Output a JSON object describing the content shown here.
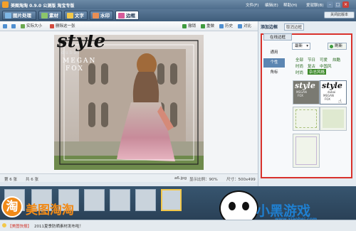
{
  "app": {
    "title": "美图淘淘 0.9.0 公测版 淘宝专版",
    "menu": [
      "文件(F)",
      "编辑(E)",
      "帮助(H)"
    ],
    "user": "爱就聊(B)",
    "new_version": "关闭此版本"
  },
  "tabs": [
    "图片处理",
    "素材",
    "文字",
    "水印",
    "边框"
  ],
  "toolbar": {
    "zoom_in": "",
    "zoom_out": "",
    "actual_size": "实际大小",
    "delete": "删除这一张",
    "undo": "撤销",
    "redo": "重做",
    "history": "历史",
    "compare": "对比"
  },
  "photo": {
    "style_word": "style",
    "subtitle": "dubai",
    "name1": "MEGAN",
    "name2": "FOX"
  },
  "status": {
    "index": "第 6 张",
    "total": "共 6 张",
    "filename": "a6.jpg",
    "zoom": "显示比例：90%",
    "size": "尺寸：500x499"
  },
  "panel": {
    "tab_add": "添加边框",
    "tab_cancel": "取消边框",
    "online": "在线边框",
    "sidebar": [
      "通用",
      "个性",
      "角标"
    ],
    "filter": "最新",
    "refresh": "刷新",
    "categories": [
      [
        "全部",
        "节日",
        "可爱",
        "炫酷"
      ],
      [
        "时尚",
        "复古",
        "中国风"
      ],
      [
        "时尚",
        "杂志风格"
      ]
    ],
    "highlight": "杂志风格"
  },
  "thumb": {
    "style_word": "style",
    "sub": "dubai",
    "name1": "MEGAN",
    "name2": "FOX"
  },
  "news": {
    "prefix": "【美图快报】",
    "text": "2011夏季防晒素材发布啦！"
  },
  "brand": {
    "logo_char": "淘",
    "name": "美图淘淘",
    "site_big": "小黑游戏",
    "site_url": "www.xiaohei.com"
  },
  "colors": {
    "accent": "#d9322c",
    "brand_orange": "#f08a18",
    "link_green": "#2a6a20"
  }
}
